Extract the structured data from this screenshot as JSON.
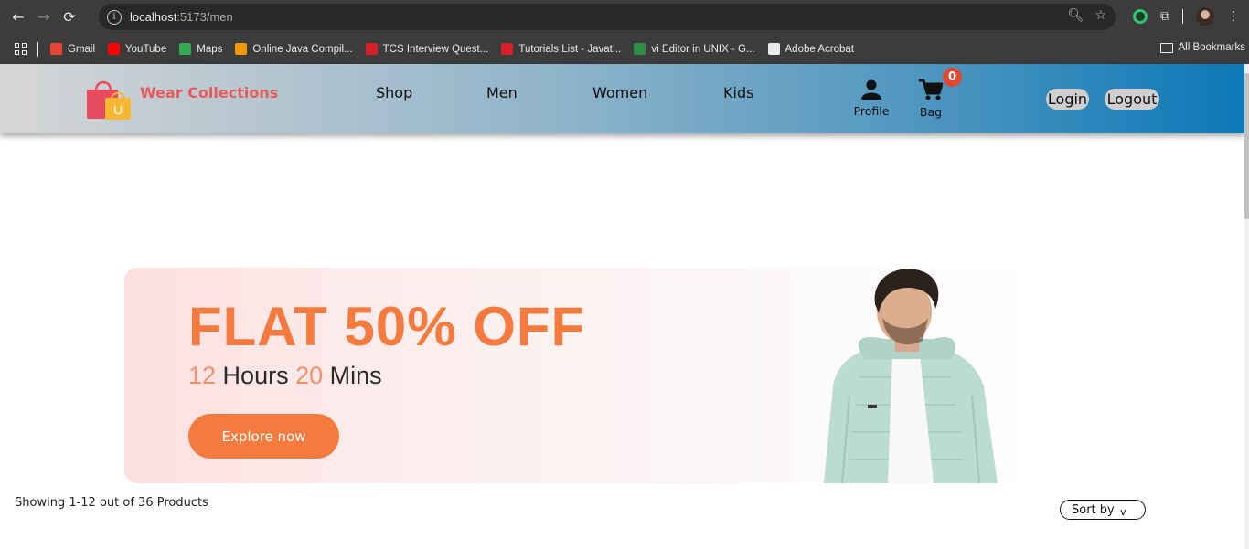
{
  "browser": {
    "url_host": "localhost",
    "url_path": ":5173/men",
    "bookmarks": [
      {
        "label": "Gmail",
        "icon": "gmail-icon",
        "color": "#ea4335"
      },
      {
        "label": "YouTube",
        "icon": "youtube-icon",
        "color": "#ff0000"
      },
      {
        "label": "Maps",
        "icon": "maps-icon",
        "color": "#34a853"
      },
      {
        "label": "Online Java Compil...",
        "icon": "sun-icon",
        "color": "#f29900"
      },
      {
        "label": "TCS Interview Quest...",
        "icon": "tcs-icon",
        "color": "#d61f26"
      },
      {
        "label": "Tutorials List - Javat...",
        "icon": "javatpoint-icon",
        "color": "#d61f26"
      },
      {
        "label": "vi Editor in UNIX - G...",
        "icon": "gfg-icon",
        "color": "#2f8d46"
      },
      {
        "label": "Adobe Acrobat",
        "icon": "globe-icon",
        "color": "#e8eaed"
      }
    ],
    "all_bookmarks": "All Bookmarks"
  },
  "header": {
    "brand": "Wear Collections",
    "nav": [
      "Shop",
      "Men",
      "Women",
      "Kids"
    ],
    "profile_label": "Profile",
    "bag_label": "Bag",
    "bag_count": "0",
    "login": "Login",
    "logout": "Logout",
    "accent_color": "#e85b5b"
  },
  "banner": {
    "headline": "FLAT 50% OFF",
    "hours_value": "12",
    "hours_label": " Hours ",
    "mins_value": "20",
    "mins_label": " Mins",
    "cta": "Explore now",
    "accent_color": "#f57a3d"
  },
  "listing": {
    "showing": "Showing 1-12 out of 36 Products",
    "sort_label": "Sort by",
    "sort_chevron": "v"
  }
}
